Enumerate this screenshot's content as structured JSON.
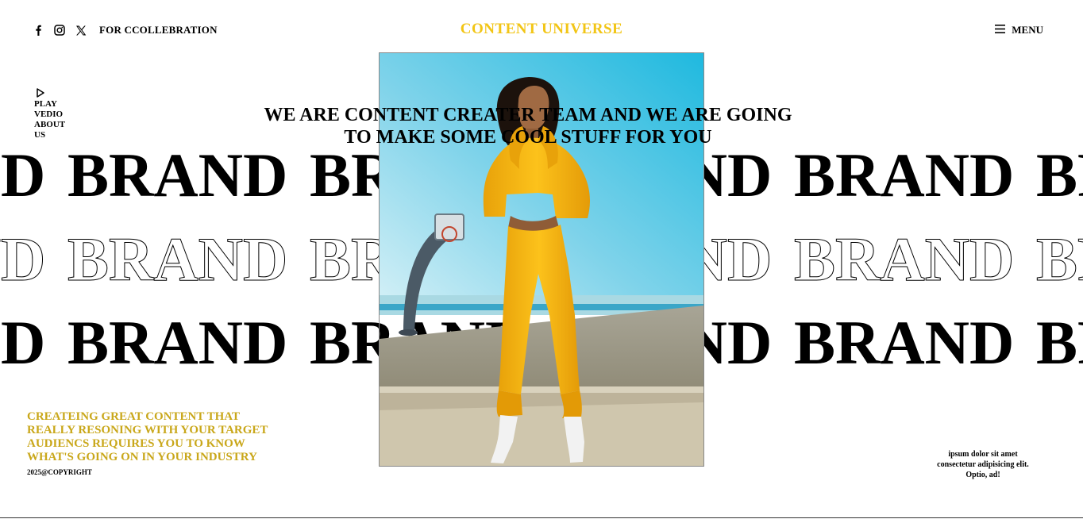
{
  "header": {
    "social_icons": [
      "facebook-icon",
      "instagram-icon",
      "x-icon"
    ],
    "collab_label": "FOR CCOLLEBRATION",
    "brand_title": "CONTENT UNIVERSE",
    "menu_label": "MENU",
    "brand_color": "#f2c515"
  },
  "hero": {
    "play_label": "PLAY VEDIO ABOUT US",
    "headline_line1": "WE ARE CONTENT CREATER TEAM AND WE ARE GOING",
    "headline_line2": "TO MAKE SOME COOL STUFF FOR YOU",
    "marquee_word": "BRAND",
    "marquee_rows": [
      "solid",
      "outline",
      "solid"
    ],
    "image_subject": "woman in yellow hoodie and sweatpants at a basketball court"
  },
  "footer": {
    "tagline": "CREATEING GREAT CONTENT THAT REALLY RESONING WITH YOUR TARGET AUDIENCS REQUIRES YOU TO KNOW WHAT'S GOING ON IN YOUR INDUSTRY",
    "tagline_color": "#c9a71a",
    "copyright": "2025@COPYRIGHT",
    "lorem": "ipsum dolor sit amet consectetur adipisicing elit. Optio, ad!"
  }
}
